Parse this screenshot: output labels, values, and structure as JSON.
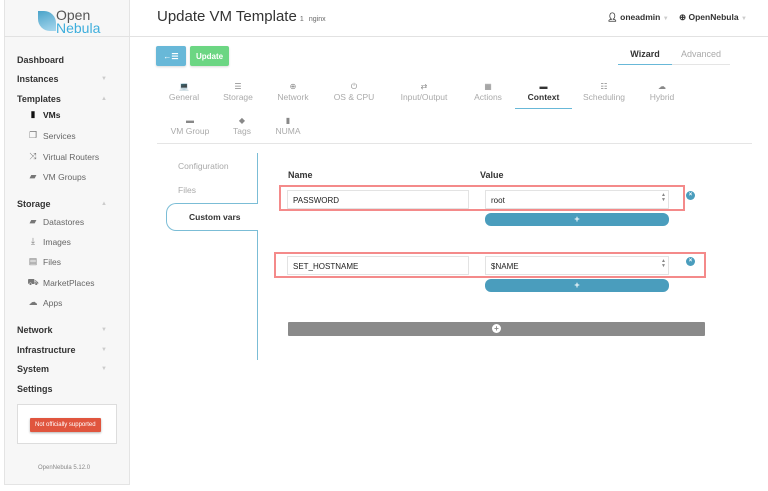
{
  "logo": {
    "line1": "Open",
    "line2": "Nebula"
  },
  "header": {
    "title": "Update VM Template",
    "template_id": "1",
    "template_name": "nginx",
    "user": "oneadmin",
    "zone": "OpenNebula"
  },
  "sidebar": {
    "dashboard": "Dashboard",
    "instances": "Instances",
    "templates": "Templates",
    "template_items": [
      "VMs",
      "Services",
      "Virtual Routers",
      "VM Groups"
    ],
    "storage": "Storage",
    "storage_items": [
      "Datastores",
      "Images",
      "Files",
      "MarketPlaces",
      "Apps"
    ],
    "network": "Network",
    "infrastructure": "Infrastructure",
    "system": "System",
    "settings": "Settings",
    "warning": "Not officially supported",
    "version": "OpenNebula 5.12.0"
  },
  "toolbar": {
    "back_icon": "←☰",
    "update": "Update",
    "wizard": "Wizard",
    "advanced": "Advanced"
  },
  "tabs": [
    {
      "label": "General",
      "icon": "💻"
    },
    {
      "label": "Storage",
      "icon": "☰"
    },
    {
      "label": "Network",
      "icon": "⊕"
    },
    {
      "label": "OS & CPU",
      "icon": "⏻"
    },
    {
      "label": "Input/Output",
      "icon": "⇄"
    },
    {
      "label": "Actions",
      "icon": "▦"
    },
    {
      "label": "Context",
      "icon": "▬"
    },
    {
      "label": "Scheduling",
      "icon": "☷"
    },
    {
      "label": "Hybrid",
      "icon": "☁"
    },
    {
      "label": "VM Group",
      "icon": "▬"
    },
    {
      "label": "Tags",
      "icon": "◆"
    },
    {
      "label": "NUMA",
      "icon": "▮"
    }
  ],
  "context": {
    "subtabs": [
      "Configuration",
      "Files",
      "Custom vars"
    ],
    "name_header": "Name",
    "value_header": "Value",
    "vars": [
      {
        "name": "PASSWORD",
        "value": "root"
      },
      {
        "name": "SET_HOSTNAME",
        "value": "$NAME"
      }
    ],
    "plus": "+",
    "remove": "×",
    "add": "+"
  },
  "colors": {
    "accent": "#4a9dbd",
    "update": "#6cd683",
    "highlight": "#f48a8a",
    "warning": "#e0553e"
  }
}
